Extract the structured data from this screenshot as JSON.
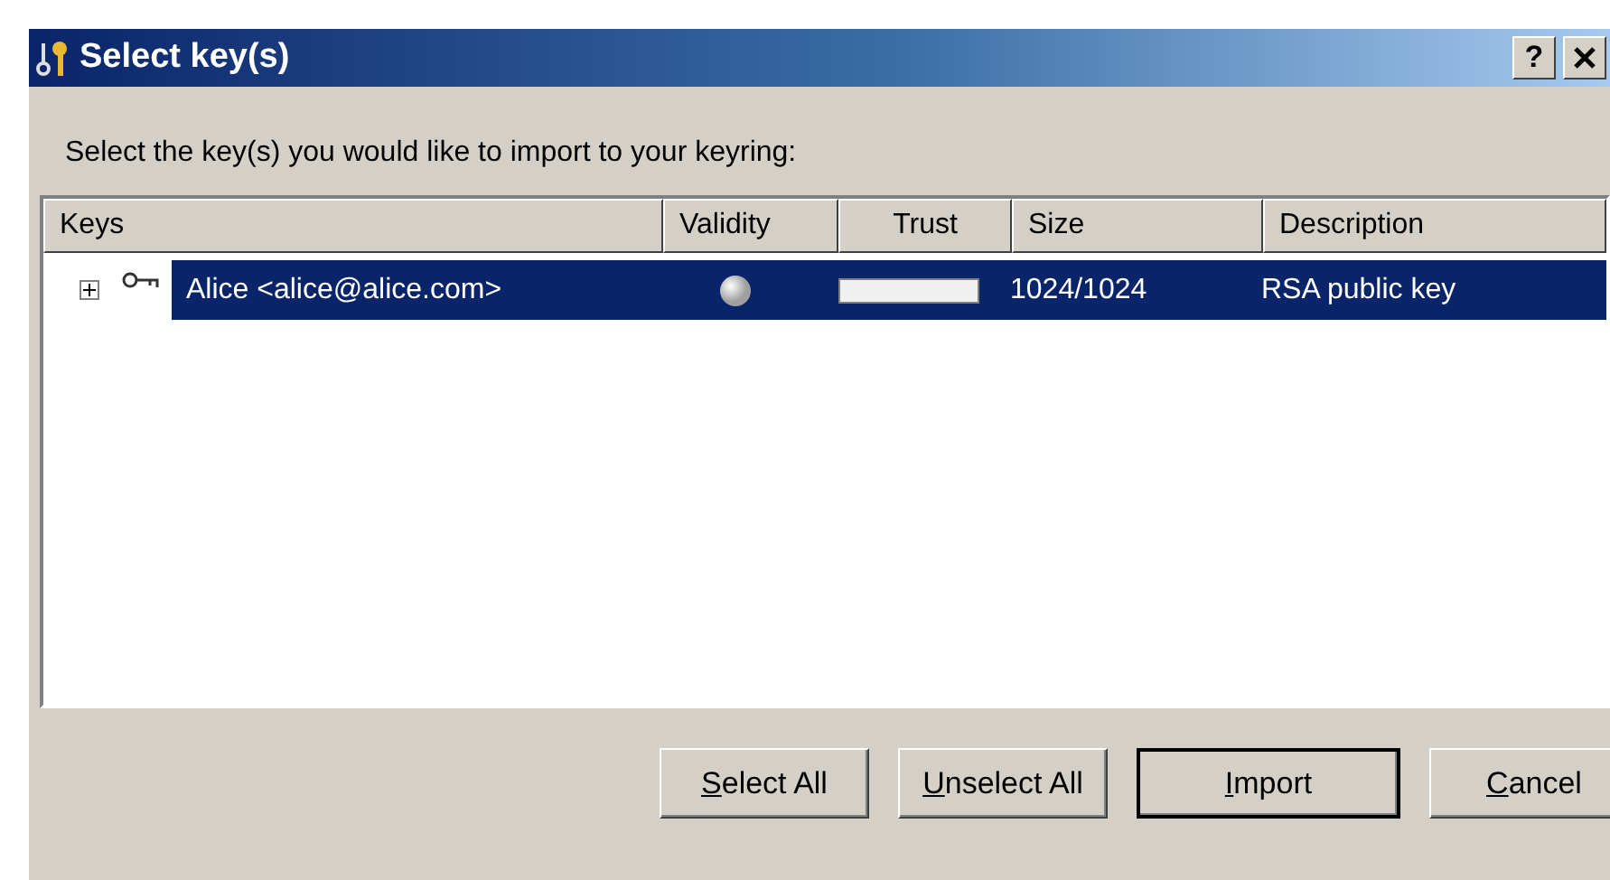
{
  "window": {
    "title": "Select key(s)",
    "help_button": "?"
  },
  "instruction": "Select the key(s) you would like to import to your keyring:",
  "table": {
    "columns": [
      "Keys",
      "Validity",
      "Trust",
      "Size",
      "Description"
    ],
    "rows": [
      {
        "name": "Alice <alice@alice.com>",
        "expanded": false,
        "selected": true,
        "trust": {
          "level": 1
        },
        "size": "1024/1024",
        "description": "RSA public key"
      }
    ]
  },
  "buttons": [
    {
      "label": "Select All",
      "default": false
    },
    {
      "label": "Unselect All",
      "default": false
    },
    {
      "label": "Import",
      "default": true
    },
    {
      "label": "Cancel",
      "default": false
    }
  ]
}
